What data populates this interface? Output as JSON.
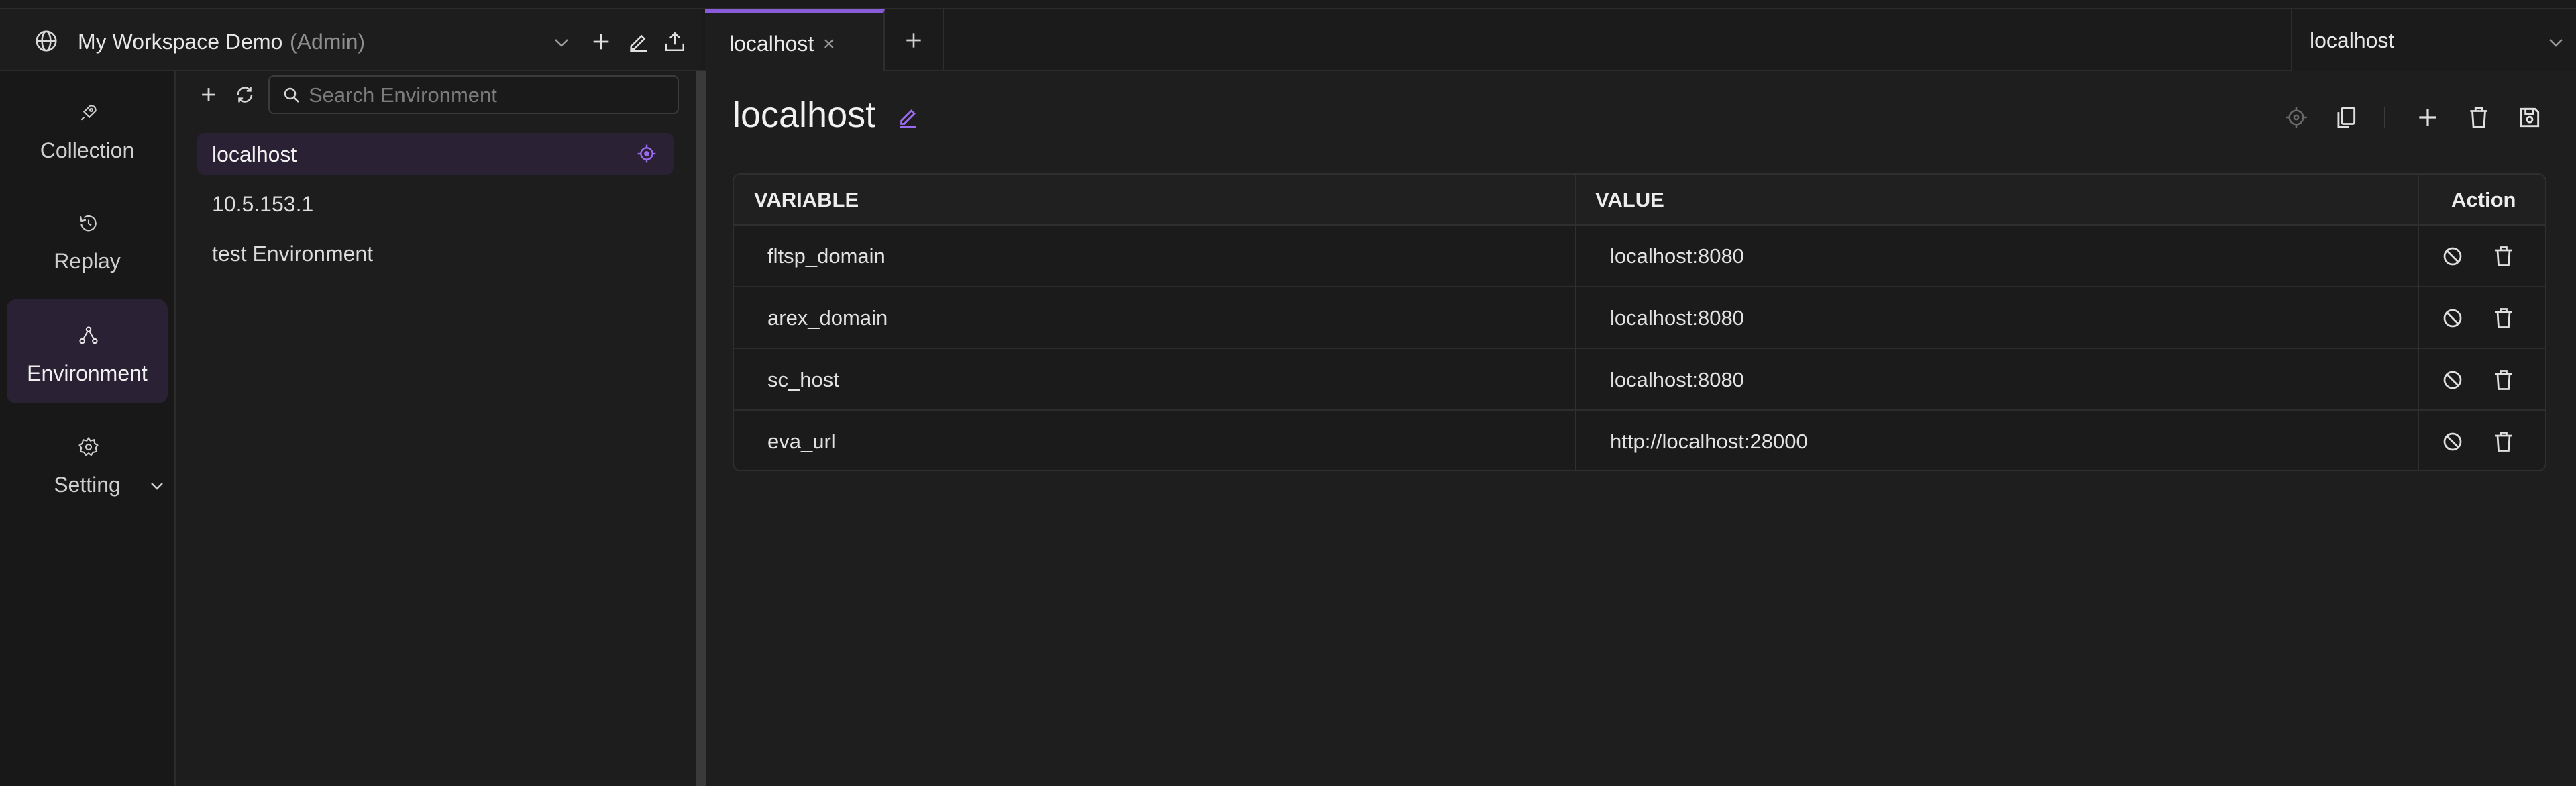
{
  "workspace": {
    "name": "My Workspace Demo",
    "role": "(Admin)"
  },
  "tabs": [
    {
      "label": "localhost",
      "close": "×"
    }
  ],
  "env_selector": {
    "value": "localhost"
  },
  "nav": {
    "items": [
      {
        "label": "Collection",
        "icon": "rocket-icon"
      },
      {
        "label": "Replay",
        "icon": "history-icon"
      },
      {
        "label": "Environment",
        "icon": "share-nodes-icon"
      },
      {
        "label": "Setting",
        "icon": "gear-icon"
      }
    ]
  },
  "envlist": {
    "search_placeholder": "Search Environment",
    "items": [
      "localhost",
      "10.5.153.1",
      "test Environment"
    ]
  },
  "main": {
    "title": "localhost",
    "table": {
      "headers": [
        "VARIABLE",
        "VALUE",
        "Action"
      ],
      "rows": [
        {
          "variable": "fltsp_domain",
          "value": "localhost:8080"
        },
        {
          "variable": "arex_domain",
          "value": "localhost:8080"
        },
        {
          "variable": "sc_host",
          "value": "localhost:8080"
        },
        {
          "variable": "eva_url",
          "value": "http://localhost:28000"
        }
      ]
    }
  },
  "colors": {
    "accent": "#9b6cf0",
    "selected_bg": "#2a2134",
    "background": "#1e1e1e"
  }
}
